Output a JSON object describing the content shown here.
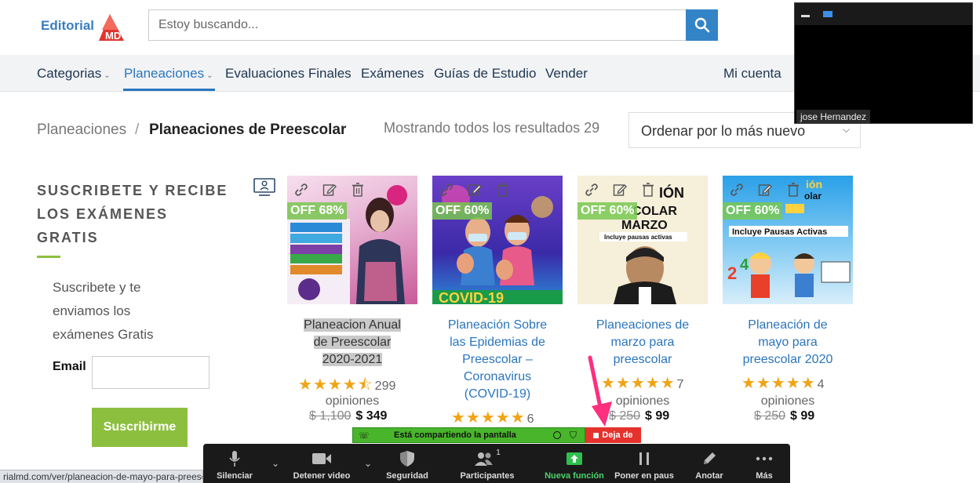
{
  "brand": {
    "name": "Editorial",
    "mark": "MD",
    "accent": "#2a75bd",
    "green": "#8dbf3f"
  },
  "search": {
    "placeholder": "Estoy buscando..."
  },
  "nav": {
    "items": [
      {
        "label": "Categorias",
        "caret": "⌄"
      },
      {
        "label": "Planeaciones",
        "caret": "⌄"
      },
      {
        "label": "Evaluaciones Finales"
      },
      {
        "label": "Exámenes"
      },
      {
        "label": "Guías de Estudio"
      },
      {
        "label": "Vender"
      }
    ],
    "account": "Mi cuenta"
  },
  "breadcrumb": {
    "parent": "Planeaciones",
    "sep": "/",
    "current": "Planeaciones de Preescolar"
  },
  "results": "Mostrando todos los resultados 29",
  "orderby": {
    "selected": "Ordenar por lo más nuevo"
  },
  "sidebar": {
    "title_lines": [
      "SUSCRIBETE Y RECIBE",
      "LOS EXÁMENES",
      "GRATIS"
    ],
    "text_lines": [
      "Suscribete y te",
      "enviamos los",
      "exámenes Gratis"
    ],
    "email_label": "Email",
    "button": "Suscribirme"
  },
  "products": [
    {
      "badge": "OFF 68%",
      "title_lines": [
        "Planeacion Anual",
        "de Preescolar",
        "2020-2021"
      ],
      "rating": 4.5,
      "stars": "★★★★⯪",
      "reviews": "299",
      "reviews_word": "opiniones",
      "old_price": "$ 1,100",
      "price": "$ 349",
      "bg": "#c85b9a"
    },
    {
      "badge": "OFF 60%",
      "title_lines": [
        "Planeación Sobre",
        "las Epidemias de",
        "Preescolar –",
        "Coronavirus",
        "(COVID-19)"
      ],
      "rating": 5,
      "stars": "★★★★★",
      "reviews": "6",
      "reviews_word": "",
      "old_price": "",
      "price": "",
      "bg": "#4d3fb5"
    },
    {
      "badge": "OFF 60%",
      "title_lines": [
        "Planeaciones de",
        "marzo para",
        "preescolar"
      ],
      "rating": 5,
      "stars": "★★★★★",
      "reviews": "7",
      "reviews_word": "opiniones",
      "old_price": "$ 250",
      "price": "$ 99",
      "bg": "#f3e7c9"
    },
    {
      "badge": "OFF 60%",
      "title_lines": [
        "Planeación de",
        "mayo para",
        "preescolar 2020"
      ],
      "rating": 5,
      "stars": "★★★★★",
      "reviews": "4",
      "reviews_word": "opiniones",
      "old_price": "$ 250",
      "price": "$ 99",
      "bg": "#5fb8e8"
    }
  ],
  "zoom": {
    "participant_name": "jose Hernandez",
    "sharing_text": "Está compartiendo la pantalla",
    "stop_label": "Deja de",
    "participants_count": "1",
    "toolbar": [
      {
        "label": "Silenciar",
        "icon": "microphone-icon"
      },
      {
        "label": "Detener video",
        "icon": "video-camera-icon"
      },
      {
        "label": "Seguridad",
        "icon": "shield-icon"
      },
      {
        "label": "Participantes",
        "icon": "participants-icon"
      },
      {
        "label": "Nueva función",
        "icon": "share-up-icon"
      },
      {
        "label": "Poner en paus",
        "icon": "pause-icon"
      },
      {
        "label": "Anotar",
        "icon": "pencil-icon"
      },
      {
        "label": "Más",
        "icon": "more-dots-icon"
      }
    ]
  },
  "status_url": "rialmd.com/ver/planeacion-de-mayo-para-preesc"
}
